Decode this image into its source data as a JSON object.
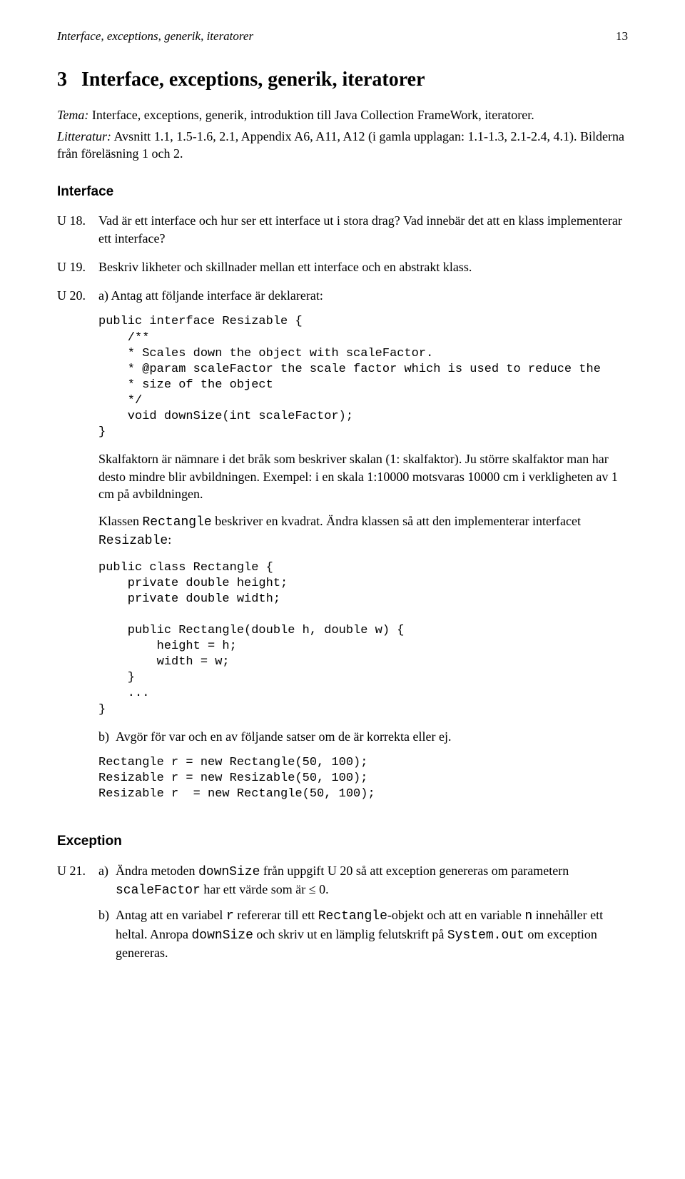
{
  "runningHead": "Interface, exceptions, generik, iteratorer",
  "pageNumber": "13",
  "section": {
    "number": "3",
    "title": "Interface, exceptions, generik, iteratorer"
  },
  "temaLabel": "Tema:",
  "temaText": " Interface, exceptions, generik, introduktion till Java Collection FrameWork, iteratorer.",
  "litteraturLabel": "Litteratur:",
  "litteraturText": " Avsnitt 1.1, 1.5-1.6, 2.1, Appendix A6, A11, A12 (i gamla upplagan: 1.1-1.3, 2.1-2.4, 4.1). Bilderna från föreläsning 1 och 2.",
  "subhead1": "Interface",
  "u18": {
    "label": "U 18.",
    "text": "Vad är ett interface och hur ser ett interface ut i stora drag? Vad innebär det att en klass implementerar ett interface?"
  },
  "u19": {
    "label": "U 19.",
    "text": "Beskriv likheter och skillnader mellan ett interface och en abstrakt klass."
  },
  "u20": {
    "label": "U 20.",
    "aLabel": "a)",
    "aText": "Antag att följande interface är deklarerat:",
    "code1": "public interface Resizable {\n    /**\n    * Scales down the object with scaleFactor.\n    * @param scaleFactor the scale factor which is used to reduce the\n    * size of the object\n    */\n    void downSize(int scaleFactor);\n}",
    "para1": "Skalfaktorn är nämnare i det bråk som beskriver skalan (1: skalfaktor). Ju större skalfaktor man har desto mindre blir avbildningen. Exempel: i en skala 1:10000 motsvaras 10000 cm i verkligheten av 1 cm på avbildningen.",
    "para2a": "Klassen ",
    "para2code1": "Rectangle",
    "para2b": " beskriver en kvadrat. Ändra klassen så att den implementerar interfacet ",
    "para2code2": "Resizable",
    "para2c": ":",
    "code2": "public class Rectangle {\n    private double height;\n    private double width;\n\n    public Rectangle(double h, double w) {\n        height = h;\n        width = w;\n    }\n    ...\n}",
    "bLabel": "b)",
    "bText": "Avgör för var och en av följande satser om de är korrekta eller ej.",
    "code3": "Rectangle r = new Rectangle(50, 100);\nResizable r = new Resizable(50, 100);\nResizable r  = new Rectangle(50, 100);"
  },
  "subhead2": "Exception",
  "u21": {
    "label": "U 21.",
    "aLabel": "a)",
    "aText1": "Ändra metoden ",
    "aCode1": "downSize",
    "aText2": " från uppgift U 20 så att exception genereras om parametern ",
    "aCode2": "scaleFactor",
    "aText3": " har ett värde som är ≤ 0.",
    "bLabel": "b)",
    "bText1": "Antag att en variabel ",
    "bCode1": "r",
    "bText2": " refererar till ett ",
    "bCode2": "Rectangle",
    "bText3": "-objekt och att en variable ",
    "bCode3": "n",
    "bText4": " innehåller ett heltal. Anropa ",
    "bCode4": "downSize",
    "bText5": " och skriv ut en lämplig felutskrift på ",
    "bCode5": "System.out",
    "bText6": " om exception genereras."
  }
}
